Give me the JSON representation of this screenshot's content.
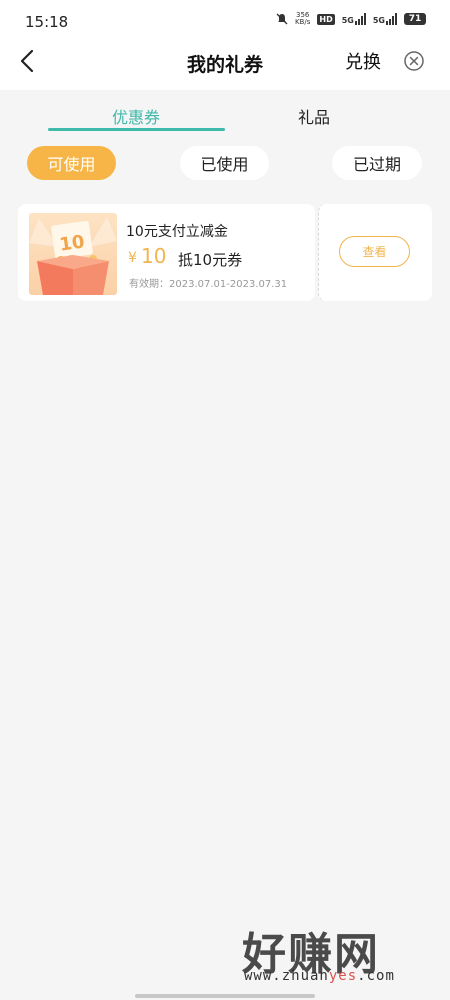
{
  "status_bar": {
    "time": "15:18",
    "speed_value": "356",
    "speed_unit": "KB/s",
    "hd_label": "HD",
    "net1": "5G",
    "net2": "5G",
    "battery": "71"
  },
  "header": {
    "title": "我的礼券",
    "exchange_label": "兑换"
  },
  "tabs": [
    {
      "label": "优惠券",
      "active": true
    },
    {
      "label": "礼品",
      "active": false
    }
  ],
  "filters": [
    {
      "label": "可使用",
      "active": true
    },
    {
      "label": "已使用",
      "active": false
    },
    {
      "label": "已过期",
      "active": false
    }
  ],
  "coupon": {
    "thumb_badge": "10",
    "name": "10元支付立减金",
    "currency": "¥",
    "amount": "10",
    "desc": "抵10元券",
    "validity": "有效期：2023.07.01-2023.07.31",
    "view_label": "查看"
  },
  "watermark": {
    "title": "好赚网",
    "url_prefix": "www.zhuan",
    "url_highlight": "yes",
    "url_suffix": ".com"
  },
  "colors": {
    "accent_teal": "#3fb9a9",
    "accent_orange": "#f7b548",
    "coupon_gold": "#f1b44e"
  }
}
